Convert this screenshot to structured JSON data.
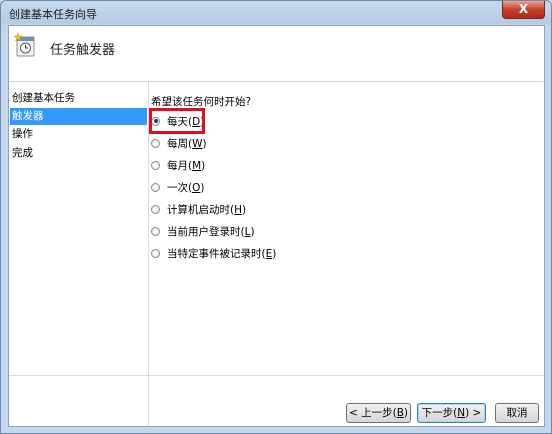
{
  "window": {
    "title": "创建基本任务向导",
    "close_label": "X"
  },
  "header": {
    "title": "任务触发器",
    "icon": "clock-task-icon"
  },
  "steps": [
    {
      "label": "创建基本任务",
      "selected": false
    },
    {
      "label": "触发器",
      "selected": true
    },
    {
      "label": "操作",
      "selected": false
    },
    {
      "label": "完成",
      "selected": false
    }
  ],
  "question": "希望该任务何时开始?",
  "options": [
    {
      "label": "每天(",
      "key": "D",
      "checked": true
    },
    {
      "label": "每周(",
      "key": "W",
      "checked": false
    },
    {
      "label": "每月(",
      "key": "M",
      "checked": false
    },
    {
      "label": "一次(",
      "key": "O",
      "checked": false
    },
    {
      "label": "计算机启动时(",
      "key": "H",
      "checked": false
    },
    {
      "label": "当前用户登录时(",
      "key": "L",
      "checked": false
    },
    {
      "label": "当特定事件被记录时(",
      "key": "E",
      "checked": false
    }
  ],
  "buttons": {
    "back": {
      "prefix": "< 上一步(",
      "key": "B",
      "suffix": ")"
    },
    "next": {
      "prefix": "下一步(",
      "key": "N",
      "suffix": ") >"
    },
    "cancel": "取消"
  }
}
